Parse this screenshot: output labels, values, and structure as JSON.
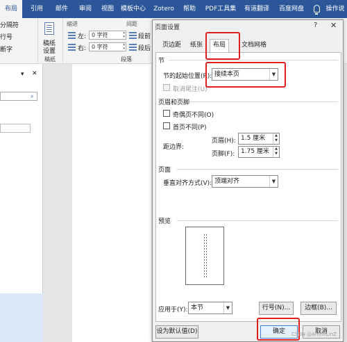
{
  "ribbon_tabs": [
    "布局",
    "引用",
    "邮件",
    "审阅",
    "视图",
    "模板中心",
    "Zotero",
    "帮助",
    "PDF工具集",
    "有道翻译",
    "百度网盘",
    "操作说"
  ],
  "ribbon": {
    "separator_label": "分隔符",
    "line_number_label": "行号",
    "hyphenation_label": "断字",
    "manuscript_label": "稿纸",
    "manuscript_label2": "设置",
    "manuscript_group": "稿纸",
    "indent_label": "缩进",
    "indent_left_label": "左:",
    "indent_left_value": "0 字符",
    "indent_right_label": "右:",
    "indent_right_value": "0 字符",
    "spacing_label": "间距",
    "spacing_before": "段前",
    "spacing_after": "段后",
    "paragraph_group": "段落"
  },
  "nav": {
    "close_glyph": "✕",
    "collapse_glyph": "▾",
    "search_glyph": "⌕"
  },
  "dialog": {
    "title": "页面设置",
    "help": "?",
    "close": "✕",
    "tabs": [
      "页边距",
      "纸张",
      "布局",
      "文档网格"
    ],
    "active_tab": "布局",
    "section_label": "节",
    "section_start_label": "节的起始位置(R):",
    "section_start_value": "接续本页",
    "suppress_endnotes_label": "取消尾注(U)",
    "headers_footers_label": "页眉和页脚",
    "odd_even_label": "奇偶页不同(O)",
    "first_page_label": "首页不同(P)",
    "from_edge_label": "距边界:",
    "header_label": "页眉(H):",
    "header_value": "1.5 厘米",
    "footer_label": "页脚(F):",
    "footer_value": "1.75 厘米",
    "page_label": "页面",
    "vertical_align_label": "垂直对齐方式(V):",
    "vertical_align_value": "顶端对齐",
    "preview_label": "预览",
    "apply_to_label": "应用于(Y):",
    "apply_to_value": "本节",
    "line_numbers_button": "行号(N)...",
    "borders_button": "边框(B)...",
    "set_default_button": "设为默认值(D)",
    "ok_button": "确定",
    "cancel_button": "取消"
  },
  "watermark": "CSDN @AntheLinZ",
  "colors": {
    "accent": "#2b579a",
    "highlight": "#e21d1d"
  }
}
